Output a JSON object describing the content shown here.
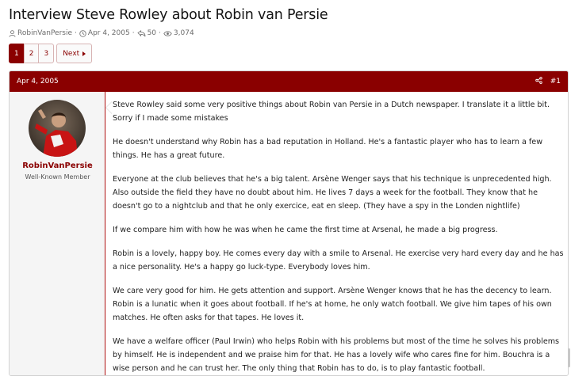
{
  "thread": {
    "title": "Interview Steve Rowley about Robin van Persie",
    "author": "RobinVanPersie",
    "date": "Apr 4, 2005",
    "replies": "50",
    "views": "3,074"
  },
  "pagination": {
    "pages": [
      "1",
      "2",
      "3"
    ],
    "current": "1",
    "next_label": "Next"
  },
  "post": {
    "date": "Apr 4, 2005",
    "number": "#1",
    "username": "RobinVanPersie",
    "user_title": "Well-Known Member",
    "paragraphs": [
      "Steve Rowley said some very positive things about Robin van Persie in a Dutch newspaper. I translate it a little bit. Sorry if I made some mistakes",
      "He doesn't understand why Robin has a bad reputation in Holland. He's a fantastic player who has to learn a few things. He has a great future.",
      "Everyone at the club believes that he's a big talent. Arsène Wenger says that his technique is unprecedented high. Also outside the field they have no doubt about him. He lives 7 days a week for the football. They know that he doesn't go to a nightclub and that he only exercice, eat en sleep. (They have a spy in the Londen nightlife)",
      "If we compare him with how he was when he came the first time at Arsenal, he made a big progress.",
      "Robin is a lovely, happy boy. He comes every day with a smile to Arsenal. He exercise very hard every day and he has a nice personality. He's a happy go luck-type. Everybody loves him.",
      "We care very good for him. He gets attention and support. Arsène Wenger knows that he has the decency to learn. Robin is a lunatic when it goes about football. If he's at home, he only watch football. We give him tapes of his own matches. He often asks for that tapes. He loves it.",
      "We have a welfare officer (Paul Irwin) who helps Robin with his problems but most of the time he solves his problems by himself. He is independent and we praise him for that. He has a lovely wife who cares fine for him. Bouchra is a wise person and he can trust her. The only thing that Robin has to do, is to play fantastic football."
    ]
  },
  "icons": {
    "author": "user-icon",
    "date": "clock-icon",
    "replies": "replies-icon",
    "views": "eye-icon",
    "share": "share-icon"
  },
  "colors": {
    "accent": "#8a0000",
    "header_text": "#ffffff",
    "sidebar_bg": "#f5f5f5"
  }
}
